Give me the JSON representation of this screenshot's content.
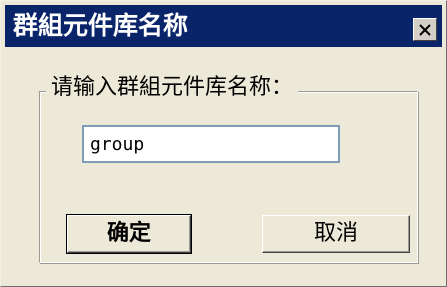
{
  "dialog": {
    "title": "群組元件库名称",
    "prompt_label": "请输入群組元件库名称：",
    "name_input": {
      "value": "group",
      "placeholder": ""
    },
    "ok_label": "确定",
    "cancel_label": "取消"
  },
  "icons": {
    "close": "close-icon"
  },
  "colors": {
    "titlebar": "#0a246a",
    "title_text": "#ffffff",
    "window_bg": "#ece9d8",
    "input_border": "#7f9db9"
  }
}
